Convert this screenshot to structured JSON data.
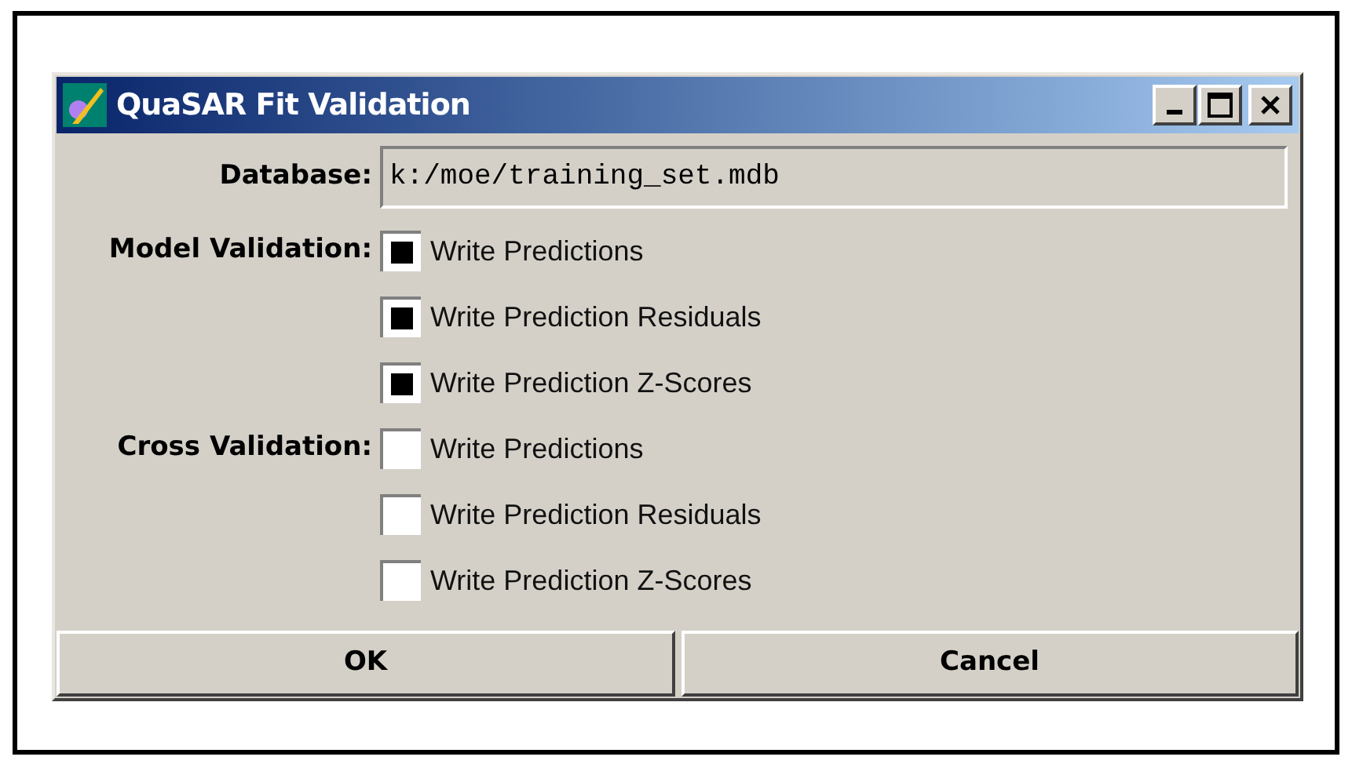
{
  "window": {
    "title": "QuaSAR Fit Validation"
  },
  "database": {
    "label": "Database:",
    "value": "k:/moe/training_set.mdb"
  },
  "groups": [
    {
      "label": "Model Validation:",
      "options": [
        {
          "label": "Write Predictions",
          "checked": true
        },
        {
          "label": "Write Prediction Residuals",
          "checked": true
        },
        {
          "label": "Write Prediction Z-Scores",
          "checked": true
        }
      ]
    },
    {
      "label": "Cross Validation:",
      "options": [
        {
          "label": "Write Predictions",
          "checked": false
        },
        {
          "label": "Write Prediction Residuals",
          "checked": false
        },
        {
          "label": "Write Prediction Z-Scores",
          "checked": false
        }
      ]
    }
  ],
  "buttons": [
    "OK",
    "Cancel"
  ]
}
